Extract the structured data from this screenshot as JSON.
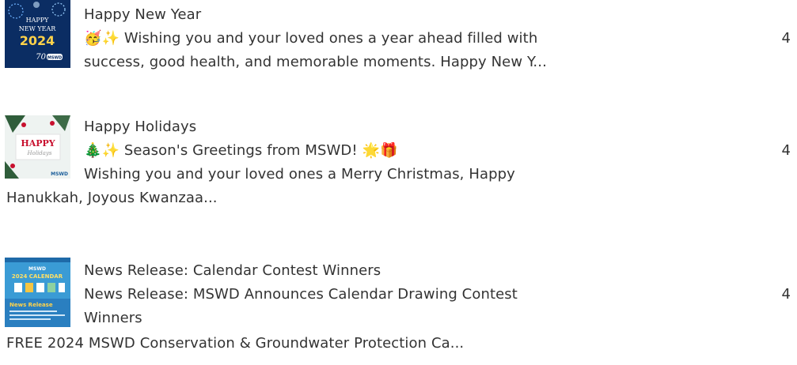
{
  "posts": [
    {
      "title": "Happy New Year",
      "line1": "🥳✨ Wishing you and your loved ones a year ahead filled with",
      "line2": "success, good health, and memorable moments. Happy New Y...",
      "count": "4",
      "thumb": {
        "line1": "HAPPY",
        "line2": "NEW YEAR",
        "year": "2024",
        "badge": "70",
        "badge_sub": "MSWD",
        "bg": "#0b2d63"
      }
    },
    {
      "title": "Happy Holidays",
      "line1": "🎄✨ Season's Greetings from MSWD! 🌟🎁",
      "line2": "Wishing you and your loved ones a Merry Christmas, Happy",
      "line3": "Hanukkah, Joyous Kwanzaa...",
      "count": "4",
      "thumb": {
        "word": "HAPPY",
        "script": "Holidays",
        "badge": "MSWD",
        "accent": "#c8102e"
      }
    },
    {
      "title": "News Release: Calendar Contest Winners",
      "line1": "News Release: MSWD Announces Calendar Drawing Contest",
      "line2": "Winners",
      "line3": "FREE 2024 MSWD Conservation & Groundwater Protection Ca...",
      "count": "4",
      "thumb": {
        "logo": "MSWD",
        "heading": "2024 CALENDAR",
        "banner": "News Release",
        "bg": "#3a9bd5"
      }
    }
  ]
}
